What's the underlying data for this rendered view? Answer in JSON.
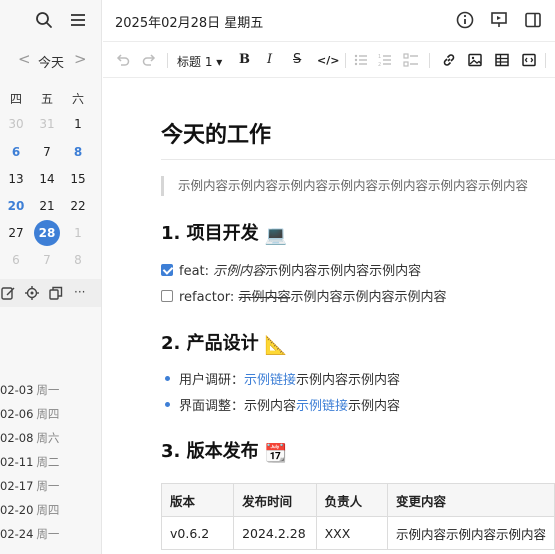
{
  "sidebar": {
    "calendar": {
      "month_label": "今天",
      "prev": "<",
      "next": ">",
      "weekdays": [
        "四",
        "五",
        "六"
      ],
      "rows": [
        [
          "30",
          "31",
          "1"
        ],
        [
          "6",
          "7",
          "8"
        ],
        [
          "13",
          "14",
          "15"
        ],
        [
          "20",
          "21",
          "22"
        ],
        [
          "27",
          "28",
          "1"
        ],
        [
          "6",
          "7",
          "8"
        ]
      ]
    },
    "tools_more": "···",
    "entries": [
      {
        "date": "02-03",
        "weekday": "周一"
      },
      {
        "date": "02-06",
        "weekday": "周四"
      },
      {
        "date": "02-08",
        "weekday": "周六"
      },
      {
        "date": "02-11",
        "weekday": "周二"
      },
      {
        "date": "02-17",
        "weekday": "周一"
      },
      {
        "date": "02-20",
        "weekday": "周四"
      },
      {
        "date": "02-24",
        "weekday": "周一"
      }
    ]
  },
  "topbar": {
    "date": "2025年02月28日 星期五"
  },
  "toolbar": {
    "heading_label": "标题 1 ▾",
    "bold": "B",
    "italic": "I",
    "strike": "S",
    "code": "</>"
  },
  "doc": {
    "title": "今天的工作",
    "quote": "示例内容示例内容示例内容示例内容示例内容示例内容示例内容",
    "section1": {
      "title": "1. 项目开发",
      "emoji": "💻"
    },
    "task1": {
      "prefix": "feat: ",
      "italic": "示例内容",
      "rest": "示例内容示例内容示例内容"
    },
    "task2": {
      "prefix": "refactor: ",
      "strike": "示例内容",
      "rest": "示例内容示例内容示例内容"
    },
    "section2": {
      "title": "2. 产品设计",
      "emoji": "📐"
    },
    "bullet1": {
      "label": "用户调研：",
      "link": "示例链接",
      "rest": "示例内容示例内容"
    },
    "bullet2": {
      "label": "界面调整：示例内容",
      "link": "示例链接",
      "rest": "示例内容"
    },
    "section3": {
      "title": "3. 版本发布",
      "emoji": "📆"
    },
    "table": {
      "headers": [
        "版本",
        "发布时间",
        "负责人",
        "变更内容"
      ],
      "row": [
        "v0.6.2",
        "2024.2.28",
        "XXX",
        "示例内容示例内容示例内容"
      ]
    }
  }
}
